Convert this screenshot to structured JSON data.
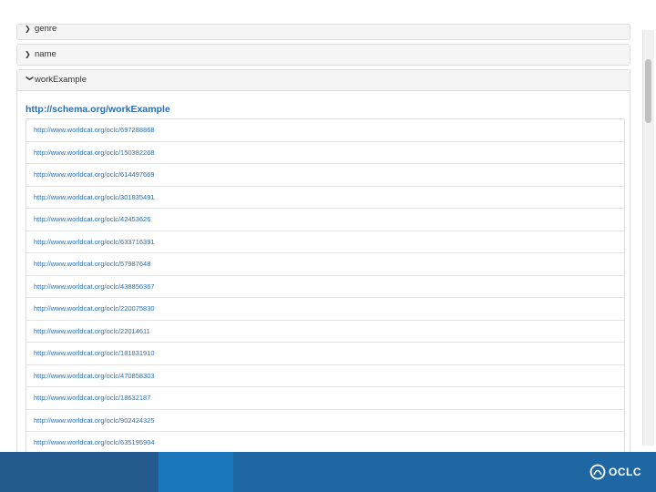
{
  "panels": {
    "genre": {
      "label": "genre",
      "icon": "chevron-right-icon"
    },
    "name": {
      "label": "name",
      "icon": "chevron-right-icon"
    },
    "workExample": {
      "label": "workExample",
      "icon": "chevron-down-icon",
      "property_url": "http://schema.org/workExample",
      "values": [
        "http://www.worldcat.org/oclc/697288868",
        "http://www.worldcat.org/oclc/150382268",
        "http://www.worldcat.org/oclc/614497669",
        "http://www.worldcat.org/oclc/301835491",
        "http://www.worldcat.org/oclc/42453626",
        "http://www.worldcat.org/oclc/633716391",
        "http://www.worldcat.org/oclc/57987648",
        "http://www.worldcat.org/oclc/438856367",
        "http://www.worldcat.org/oclc/220075830",
        "http://www.worldcat.org/oclc/22014611",
        "http://www.worldcat.org/oclc/181831910",
        "http://www.worldcat.org/oclc/470858303",
        "http://www.worldcat.org/oclc/18632187",
        "http://www.worldcat.org/oclc/902424325",
        "http://www.worldcat.org/oclc/635195904"
      ]
    }
  },
  "footer": {
    "logo_text": "OCLC",
    "colors": {
      "block1": "#245a8e",
      "block2": "#1b77bb",
      "block3": "#1f67a3"
    }
  },
  "colors": {
    "link": "#2a6fb0",
    "panel_bg": "#f5f5f5",
    "border": "#dddddd"
  }
}
